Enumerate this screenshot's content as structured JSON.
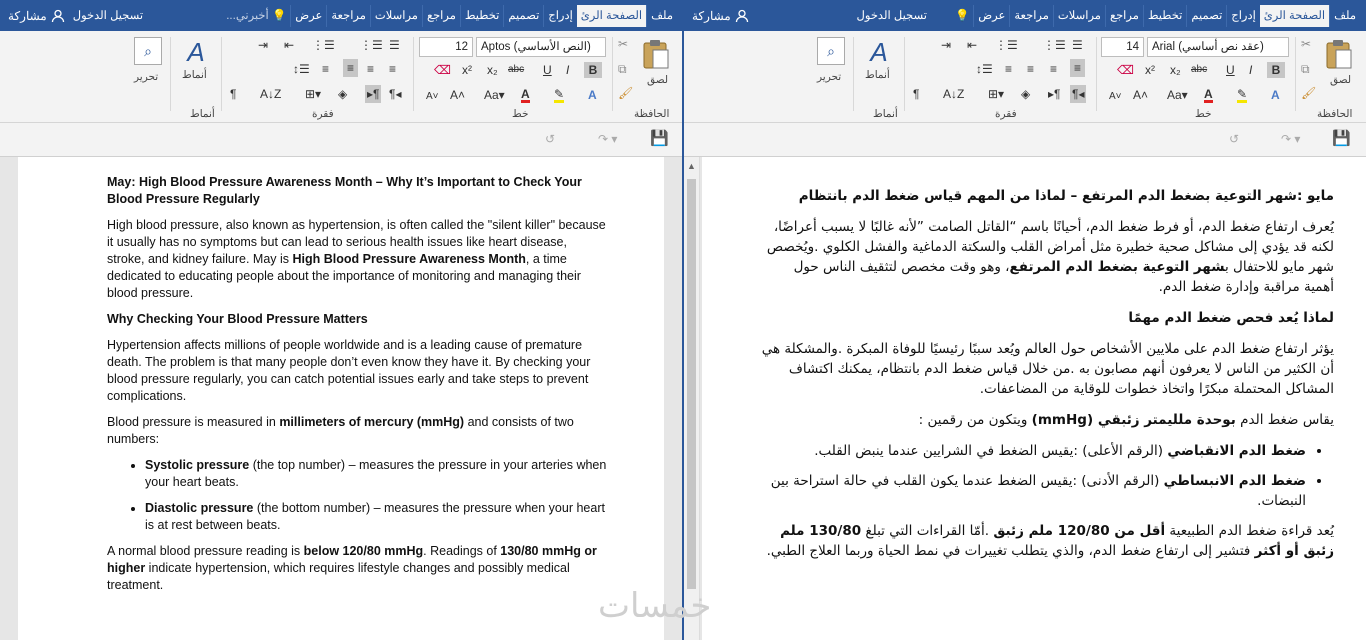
{
  "left_window": {
    "tabs": [
      "ملف",
      "الصفحة الرئ",
      "إدراج",
      "تصميم",
      "تخطيط",
      "مراجع",
      "مراسلات",
      "مراجعة",
      "عرض"
    ],
    "active_tab": "الصفحة الرئ",
    "tell_me": "أخبرني...",
    "sign_in": "تسجيل الدخول",
    "share": "مشاركة",
    "font_name": "Aptos (النص الأساسي)",
    "font_size": "12",
    "groups": {
      "clipboard": "الحافظة",
      "font": "خط",
      "paragraph": "فقرة",
      "styles": "أنماط",
      "editing": "تحرير"
    },
    "buttons": {
      "paste": "لصق",
      "styles": "أنماط",
      "editing": "تحرير"
    },
    "document": {
      "title": "May: High Blood Pressure Awareness Month – Why It’s Important to Check Your Blood Pressure Regularly",
      "p1a": "High blood pressure, also known as hypertension, is often called the \"silent killer\" because it usually has no symptoms but can lead to serious health issues like heart disease, stroke, and kidney failure. May is ",
      "p1b": "High Blood Pressure Awareness Month",
      "p1c": ", a time dedicated to educating people about the importance of monitoring and managing their blood pressure.",
      "h2": "Why Checking Your Blood Pressure Matters",
      "p2": "Hypertension affects millions of people worldwide and is a leading cause of premature death. The problem is that many people don’t even know they have it. By checking your blood pressure regularly, you can catch potential issues early and take steps to prevent complications.",
      "p3a": "Blood pressure is measured in ",
      "p3b": "millimeters of mercury (mmHg)",
      "p3c": " and consists of two numbers:",
      "li1a": "Systolic pressure",
      "li1b": " (the top number) – measures the pressure in your arteries when your heart beats.",
      "li2a": "Diastolic pressure",
      "li2b": " (the bottom number) – measures the pressure when your heart is at rest between beats.",
      "p4a": "A normal blood pressure reading is ",
      "p4b": "below 120/80 mmHg",
      "p4c": ". Readings of ",
      "p4d": "130/80 mmHg or higher",
      "p4e": " indicate hypertension, which requires lifestyle changes and possibly medical treatment."
    }
  },
  "right_window": {
    "tabs": [
      "ملف",
      "الصفحة الرئ",
      "إدراج",
      "تصميم",
      "تخطيط",
      "مراجع",
      "مراسلات",
      "مراجعة",
      "عرض"
    ],
    "active_tab": "الصفحة الرئ",
    "sign_in": "تسجيل الدخول",
    "share": "مشاركة",
    "font_name": "Arial (عقد نص أساسي)",
    "font_size": "14",
    "groups": {
      "clipboard": "الحافظة",
      "font": "خط",
      "paragraph": "فقرة",
      "styles": "أنماط",
      "editing": "تحرير"
    },
    "buttons": {
      "paste": "لصق",
      "styles": "أنماط",
      "editing": "تحرير"
    },
    "document": {
      "title_a": "مايو :",
      "title_b": "شهر التوعية بضغط الدم المرتفع – لماذا من المهم قياس ضغط الدم بانتظام",
      "p1a": "يُعرف ارتفاع ضغط الدم، أو فرط ضغط الدم، أحيانًا باسم “القاتل الصامت ”لأنه غالبًا لا يسبب أعراضًا، لكنه قد يؤدي إلى مشاكل صحية خطيرة مثل أمراض القلب والسكتة الدماغية والفشل الكلوي .ويُخصص شهر مايو للاحتفال ب",
      "p1b": "شهر التوعية بضغط الدم المرتفع",
      "p1c": "، وهو وقت مخصص لتثقيف الناس حول أهمية مراقبة وإدارة ضغط الدم.",
      "h2": "لماذا يُعد فحص ضغط الدم مهمًا",
      "p2": "يؤثر ارتفاع ضغط الدم على ملايين الأشخاص حول العالم ويُعد سببًا رئيسيًا للوفاة المبكرة .والمشكلة هي أن الكثير من الناس لا يعرفون أنهم مصابون به .من خلال قياس ضغط الدم بانتظام، يمكنك اكتشاف المشاكل المحتملة مبكرًا واتخاذ خطوات للوقاية من المضاعفات.",
      "p3a": "يقاس ضغط الدم ",
      "p3b": "بوحدة ملليمتر زئبقي (mmHg)",
      "p3c": " ويتكون من رقمين :",
      "li1a": "ضغط الدم الانقباضي",
      "li1b": " (الرقم الأعلى) :يقيس الضغط في الشرايين عندما ينبض القلب.",
      "li2a": "ضغط الدم الانبساطي",
      "li2b": " (الرقم الأدنى) :يقيس الضغط عندما يكون القلب في حالة استراحة بين النبضات.",
      "p4a": "يُعد قراءة ضغط الدم الطبيعية ",
      "p4b": "أقل من 120/80 ملم زئبق",
      "p4c": " .أمّا القراءات التي تبلغ ",
      "p4d": "130/80 ملم زئبق أو أكثر",
      "p4e": " فتشير إلى ارتفاع ضغط الدم، والذي يتطلب تغييرات في نمط الحياة وربما العلاج الطبي."
    }
  },
  "watermark": "خمسات",
  "colors": {
    "word_blue": "#2b579a",
    "ribbon": "#f3f3f3",
    "font_red": "#e02020",
    "highlight_yellow": "#f5e600"
  }
}
